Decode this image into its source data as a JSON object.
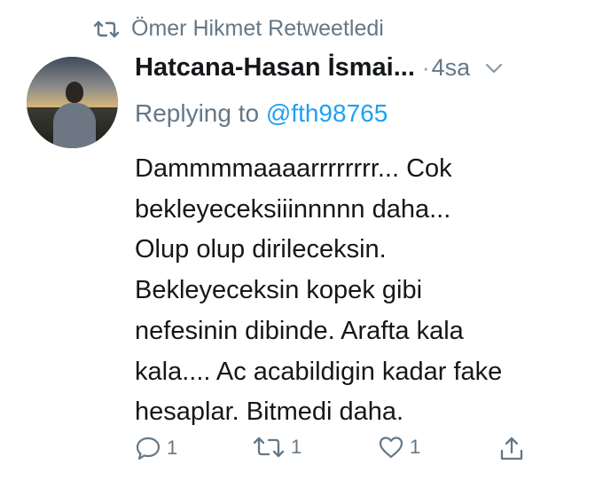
{
  "retweet_banner": {
    "icon": "retweet-icon",
    "text": "Ömer Hikmet Retweetledi"
  },
  "tweet": {
    "avatar_icon": "avatar",
    "author_name": "Hatcana-Hasan İsmai...",
    "separator": "·",
    "timestamp": "4sa",
    "menu_icon": "chevron-down-icon",
    "replying_prefix": "Replying to",
    "replying_handle": "@fth98765",
    "text": "Dammmmaaaarrrrrrrr... Cok\nbekleyeceksiiinnnnn daha...\nOlup olup dirileceksin.\nBekleyeceksin kopek gibi\nnefesinin dibinde. Arafta kala\nkala.... Ac acabildigin kadar fake\nhesaplar. Bitmedi daha.",
    "actions": {
      "reply_count": "1",
      "retweet_count": "1",
      "like_count": "1"
    }
  },
  "colors": {
    "secondary_text": "#657786",
    "link": "#1da1f2",
    "primary_text": "#14171a"
  }
}
